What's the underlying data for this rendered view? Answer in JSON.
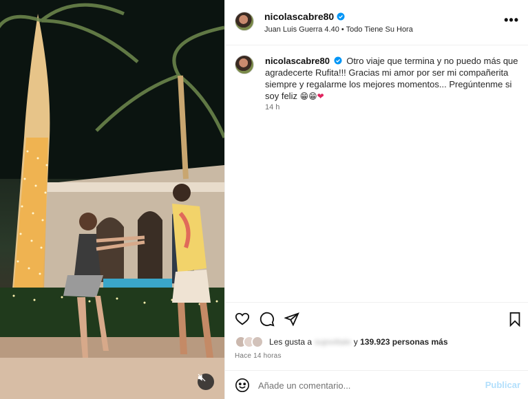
{
  "post": {
    "username": "nicolascabre80",
    "verified": true,
    "audio": "Juan Luis Guerra 4.40 • Todo Tiene Su Hora",
    "more_icon": "more-horizontal-icon"
  },
  "caption": {
    "username": "nicolascabre80",
    "text": "Otro viaje que termina y no puedo más que agradecerte Rufita!!! Gracias mi amor por ser mi compañerita siempre y regalarme los mejores momentos... Pregúntenme si soy feliz",
    "emojis": [
      "😁",
      "😁",
      "❤"
    ],
    "time": "14 h"
  },
  "actions": {
    "like_icon": "heart-icon",
    "comment_icon": "comment-icon",
    "share_icon": "send-icon",
    "save_icon": "bookmark-icon"
  },
  "likes": {
    "prefix": "Les gusta a",
    "blurred_user": "sujoviitale",
    "connector": "y",
    "count_text": "139.923 personas más"
  },
  "posted": "Hace 14 horas",
  "comment": {
    "placeholder": "Añade un comentario...",
    "publish_label": "Publicar"
  },
  "media": {
    "mute_icon": "audio-muted-icon"
  },
  "colors": {
    "verified_blue": "#0095f6",
    "publish_disabled": "#b2dffc",
    "heart_red": "#e0245e"
  }
}
